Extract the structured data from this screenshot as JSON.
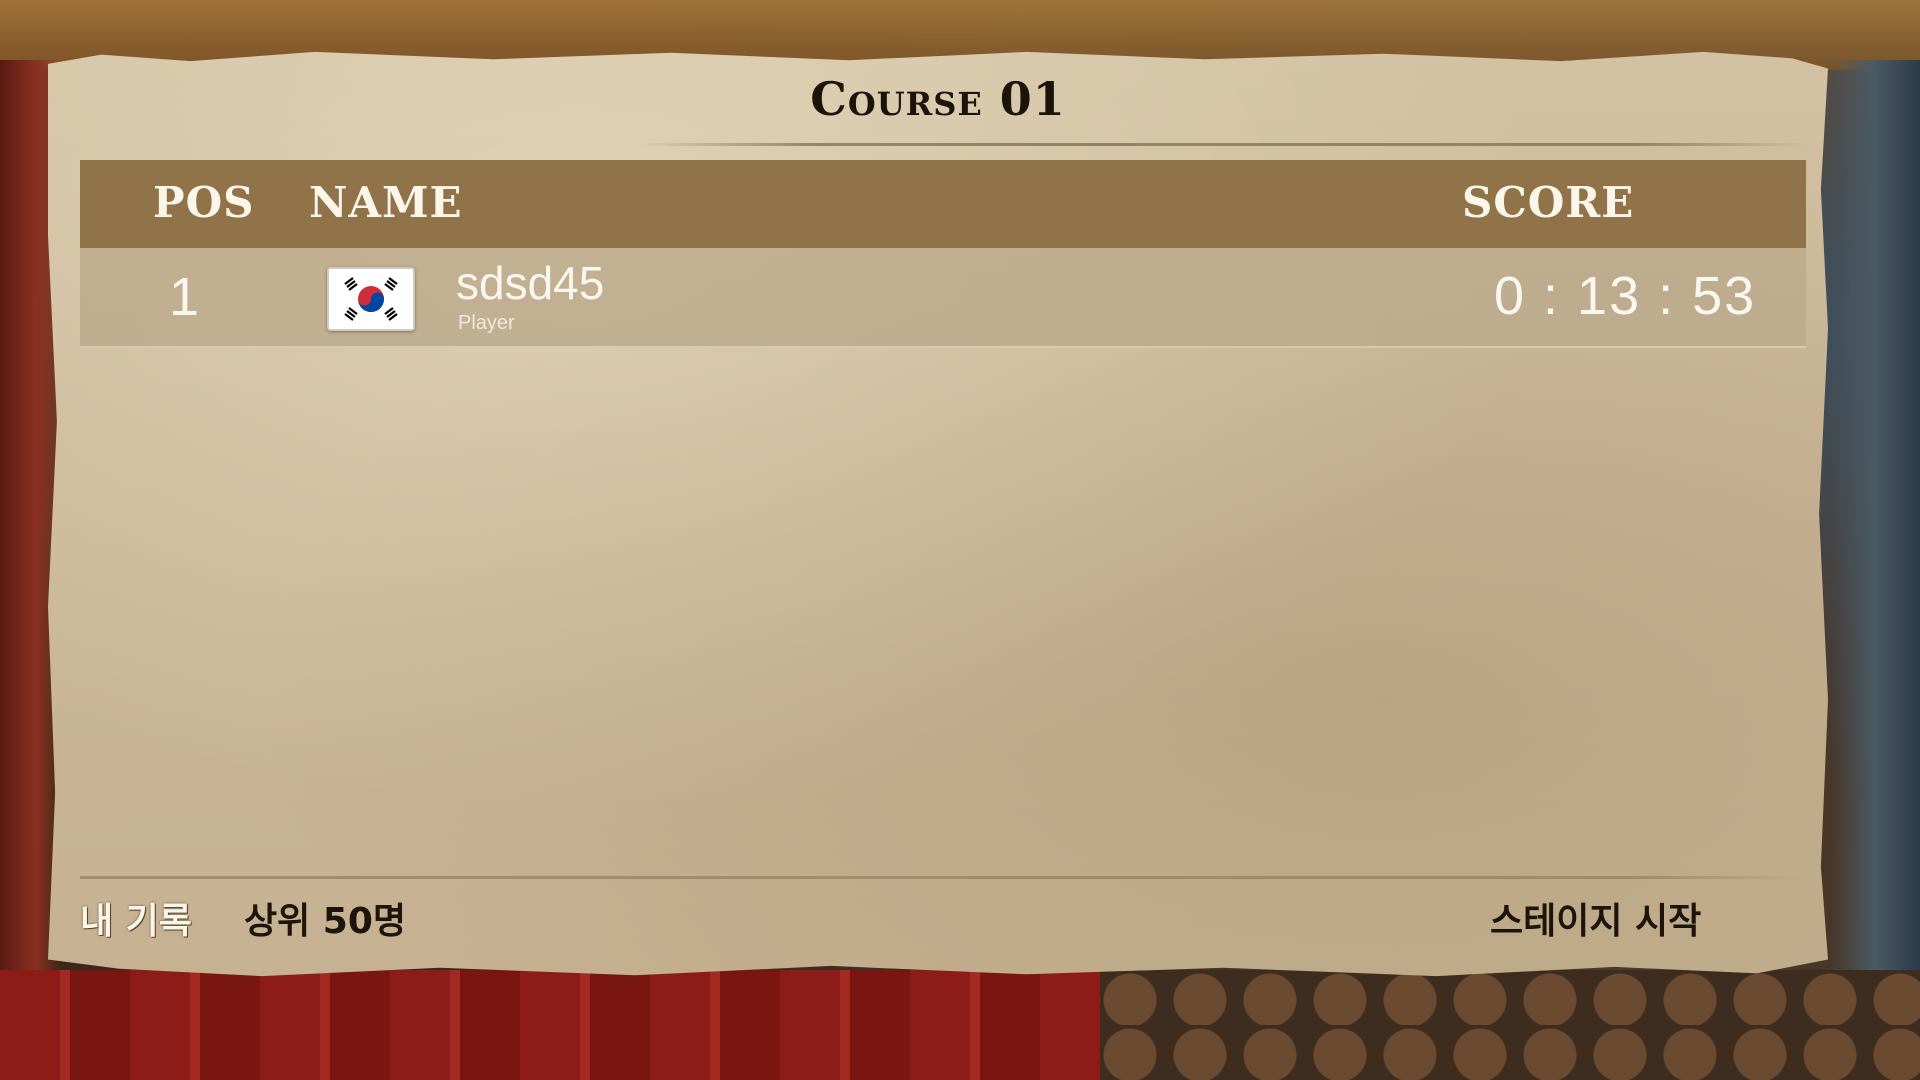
{
  "course": {
    "title": "Course 01"
  },
  "leaderboard": {
    "headers": {
      "pos": "POS",
      "name": "NAME",
      "score": "SCORE"
    },
    "rows": [
      {
        "pos": "1",
        "country_flag": "korea-flag-icon",
        "name": "sdsd45",
        "role": "Player",
        "score": "0 : 13 : 53"
      }
    ]
  },
  "footer": {
    "my_record": "내 기록",
    "top50": "상위 50명",
    "start_stage": "스테이지 시작"
  },
  "colors": {
    "header_bg": "#907349",
    "row_bg": "#bcaa8c",
    "parchment": "#cbb899",
    "title_text": "#1c1409",
    "light_text": "#fbf7ef"
  }
}
